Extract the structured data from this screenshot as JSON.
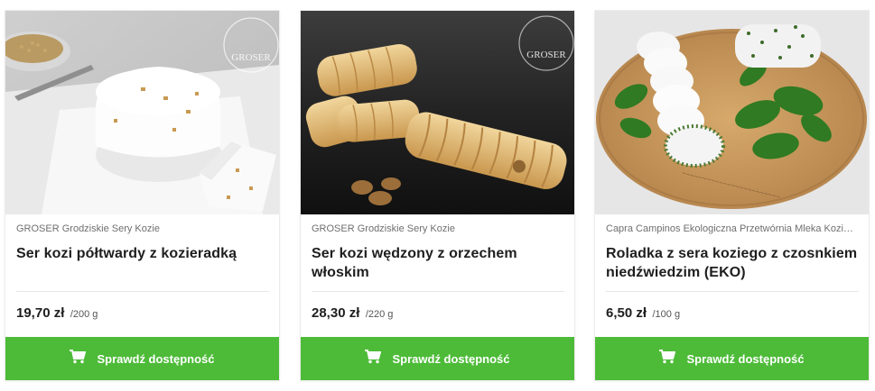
{
  "products": [
    {
      "watermark": "GROSER",
      "vendor": "GROSER Grodziskie Sery Kozie",
      "title": "Ser kozi półtwardy z kozieradką",
      "price": "19,70 zł",
      "unit": "/200 g",
      "button_label": "Sprawdź dostępność",
      "button_icon": "cart-icon"
    },
    {
      "watermark": "GROSER",
      "vendor": "GROSER Grodziskie Sery Kozie",
      "title": "Ser kozi wędzony z orzechem włoskim",
      "price": "28,30 zł",
      "unit": "/220 g",
      "button_label": "Sprawdź dostępność",
      "button_icon": "cart-icon"
    },
    {
      "vendor": "Capra Campinos Ekologiczna Przetwórnia Mleka Koziego",
      "title": "Roladka z sera koziego z czosnkiem niedźwiedzim (EKO)",
      "price": "6,50 zł",
      "unit": "/100 g",
      "button_label": "Sprawdź dostępność",
      "button_icon": "cart-icon"
    }
  ],
  "colors": {
    "button_green": "#4dbb38",
    "title_text": "#1e1e1e",
    "vendor_text": "#6f6f6f"
  }
}
